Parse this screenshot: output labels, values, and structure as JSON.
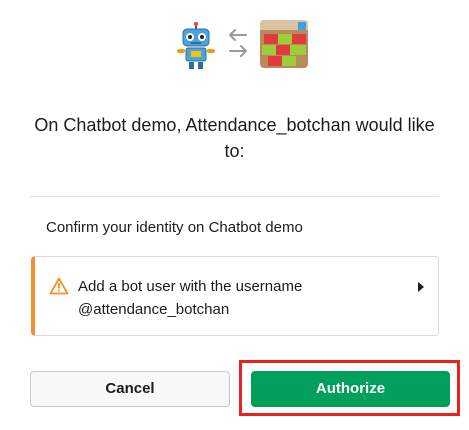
{
  "header": {
    "app_icon": "robot-icon",
    "swap_icon": "swap-arrows-icon",
    "workspace_icon": "workspace-image"
  },
  "main": {
    "heading": "On Chatbot demo, Attendance_botchan would like to:",
    "identity_text": "Confirm your identity on Chatbot demo",
    "permission": {
      "line1": "Add a bot user with the username",
      "line2": "@attendance_botchan",
      "icon": "warning-icon",
      "expand_icon": "caret-right-icon"
    }
  },
  "actions": {
    "cancel_label": "Cancel",
    "authorize_label": "Authorize"
  },
  "colors": {
    "accent_green": "#00a05a",
    "warning_orange": "#f2902b",
    "highlight_red": "#e8231f"
  }
}
